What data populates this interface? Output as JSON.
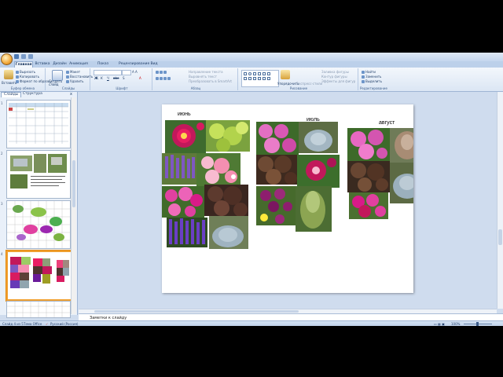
{
  "window": {
    "title": ""
  },
  "tabs": [
    "Главная",
    "Вставка",
    "Дизайн",
    "Анимация",
    "Показ слайдов",
    "Рецензирование",
    "Вид"
  ],
  "active_tab": "Главная",
  "ribbon": {
    "clipboard": {
      "paste": "Вставить",
      "cut": "Вырезать",
      "copy": "Копировать",
      "format_painter": "Формат по образцу",
      "label": "Буфер обмена"
    },
    "slides": {
      "new_slide": "Создать слайд",
      "layout": "Макет",
      "reset": "Восстановить",
      "delete": "Удалить",
      "label": "Слайды"
    },
    "font": {
      "label": "Шрифт",
      "bold": "Ж",
      "italic": "К",
      "underline": "Ч",
      "strike": "abe",
      "shadow": "S",
      "font_color": "A"
    },
    "paragraph": {
      "text_direction": "Направление текста",
      "align_text": "Выровнять текст",
      "smartart": "Преобразовать в SmartArt",
      "label": "Абзац"
    },
    "drawing": {
      "arrange": "Упорядочить",
      "quick_styles": "Экспресс-стили",
      "fill": "Заливка фигуры",
      "outline": "Контур фигуры",
      "effects": "Эффекты для фигур",
      "label": "Рисование"
    },
    "editing": {
      "find": "Найти",
      "replace": "Заменить",
      "select": "Выделить",
      "label": "Редактирование"
    }
  },
  "left_panel": {
    "tabs": [
      "Слайды",
      "Структура"
    ],
    "close": "x",
    "slide_numbers": [
      "1",
      "2",
      "3",
      "4"
    ]
  },
  "slide": {
    "months": [
      "июнь",
      "июль",
      "август"
    ]
  },
  "notes": {
    "placeholder": "Заметки к слайду"
  },
  "status": {
    "slide_info": "Слайд 4 из 5",
    "theme": "Тема Office",
    "language": "Русский (Россия)",
    "zoom": "100%"
  },
  "colors": {
    "ribbon_bg": "#dbe6f4",
    "app_bg": "#cfdcee",
    "selected_thumb": "#f0a030"
  }
}
